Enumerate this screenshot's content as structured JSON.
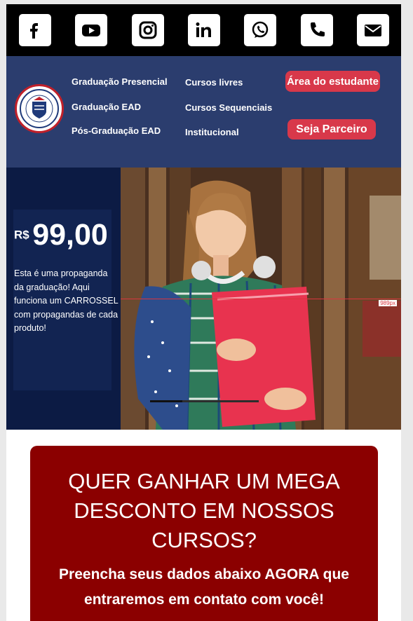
{
  "social": [
    {
      "name": "facebook-icon"
    },
    {
      "name": "youtube-icon"
    },
    {
      "name": "instagram-icon"
    },
    {
      "name": "linkedin-icon"
    },
    {
      "name": "whatsapp-icon"
    },
    {
      "name": "phone-icon"
    },
    {
      "name": "email-icon"
    }
  ],
  "nav": {
    "col1": [
      "Graduação Presencial",
      "Graduação EAD",
      "Pós-Graduação EAD"
    ],
    "col2": [
      "Cursos livres",
      "Cursos Sequenciais",
      "Institucional"
    ],
    "student_area": "Área do estudante",
    "partner": "Seja Parceiro"
  },
  "hero": {
    "currency": "R$",
    "price": "99,00",
    "text": "Esta é uma propaganda da graduação! Aqui funciona um CARROSSEL com propagandas de cada produto!",
    "ruler_label": "989px"
  },
  "promo": {
    "title": "QUER GANHAR UM MEGA DESCONTO EM NOSSOS CURSOS?",
    "subtitle": "Preencha seus dados abaixo AGORA que entraremos em contato com você!"
  },
  "colors": {
    "nav_bg": "#2b3d6e",
    "hero_left_bg": "#0c1b44",
    "button_red": "#d8384a",
    "promo_bg": "#8b0000"
  }
}
